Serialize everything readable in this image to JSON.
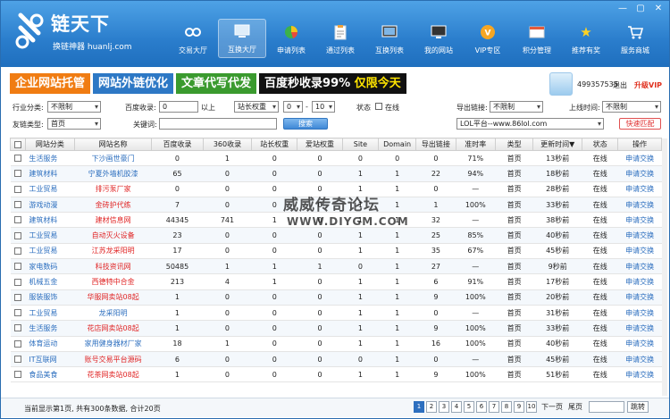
{
  "app": {
    "title": "链天下",
    "subtitle": "换链神器 huanlj.com",
    "window_controls": [
      "—",
      "▢",
      "✕"
    ]
  },
  "nav": [
    {
      "label": "交易大厅",
      "icon": "link-icon"
    },
    {
      "label": "互换大厅",
      "icon": "monitor-icon",
      "active": true
    },
    {
      "label": "申请列表",
      "icon": "pie-chart-icon"
    },
    {
      "label": "通过列表",
      "icon": "clipboard-icon"
    },
    {
      "label": "互换列表",
      "icon": "screen-icon"
    },
    {
      "label": "我的网站",
      "icon": "monitor-icon"
    },
    {
      "label": "VIP专区",
      "icon": "vip-icon"
    },
    {
      "label": "积分管理",
      "icon": "window-icon"
    },
    {
      "label": "推荐有奖",
      "icon": "star-icon"
    },
    {
      "label": "服务商城",
      "icon": "cart-icon"
    }
  ],
  "banner": {
    "b1": "企业网站托管",
    "b2": "网站外链优化",
    "b3": "文章代写代发",
    "b4_a": "百度秒收录99%",
    "b4_b": "仅限今天"
  },
  "user": {
    "id": "499357535",
    "logout": "退出",
    "upgrade": "升级VIP"
  },
  "filters": {
    "industry_label": "行业分类:",
    "industry_value": "不限制",
    "baidu_label": "百度收录:",
    "baidu_value": "0",
    "baidu_suffix": "以上",
    "weight_value": "站长权重",
    "range_from": "0",
    "range_dash": "-",
    "range_to": "10",
    "status_label": "状态",
    "online_label": "在线",
    "export_label": "导出链接:",
    "export_value": "不限制",
    "online_time_label": "上线时间:",
    "online_time_value": "不限制",
    "friend_label": "友链类型:",
    "friend_value": "首页",
    "keyword_label": "关键词:",
    "search_btn": "搜索",
    "platform_value": "LOL平台--www.86lol.com",
    "fast_btn": "快速匹配"
  },
  "table": {
    "headers": [
      "",
      "网站分类",
      "网站名称",
      "百度收录",
      "360收录",
      "站长权重",
      "爱站权重",
      "Site",
      "Domain",
      "导出链接",
      "准时率",
      "类型",
      "更新时间▼",
      "状态",
      "操作"
    ],
    "rows": [
      [
        "生活服务",
        "下沙画世豪门",
        "0",
        "1",
        "0",
        "0",
        "0",
        "0",
        "0",
        "71%",
        "首页",
        "13秒前",
        "在线",
        "申请交换"
      ],
      [
        "建筑材料",
        "宁夏外墙机胶漆",
        "65",
        "0",
        "0",
        "0",
        "1",
        "1",
        "22",
        "94%",
        "首页",
        "18秒前",
        "在线",
        "申请交换"
      ],
      [
        "工业贸易",
        "排污泵厂家",
        "0",
        "0",
        "0",
        "0",
        "1",
        "1",
        "0",
        "—",
        "首页",
        "28秒前",
        "在线",
        "申请交换"
      ],
      [
        "游戏动漫",
        "金砖护代练",
        "7",
        "0",
        "0",
        "0",
        "1",
        "1",
        "1",
        "100%",
        "首页",
        "33秒前",
        "在线",
        "申请交换"
      ],
      [
        "建筑材料",
        "建材信息网",
        "44345",
        "741",
        "1",
        "0",
        "1",
        "1",
        "32",
        "—",
        "首页",
        "38秒前",
        "在线",
        "申请交换"
      ],
      [
        "工业贸易",
        "自动灭火设备",
        "23",
        "0",
        "0",
        "0",
        "1",
        "1",
        "25",
        "85%",
        "首页",
        "40秒前",
        "在线",
        "申请交换"
      ],
      [
        "工业贸易",
        "江苏龙采阳明",
        "17",
        "0",
        "0",
        "0",
        "1",
        "1",
        "35",
        "67%",
        "首页",
        "45秒前",
        "在线",
        "申请交换"
      ],
      [
        "家电数码",
        "科技资讯网",
        "50485",
        "1",
        "1",
        "1",
        "0",
        "1",
        "27",
        "—",
        "首页",
        "9秒前",
        "在线",
        "申请交换"
      ],
      [
        "机械五金",
        "西德特中合金",
        "213",
        "4",
        "1",
        "0",
        "1",
        "1",
        "6",
        "91%",
        "首页",
        "17秒前",
        "在线",
        "申请交换"
      ],
      [
        "服装服饰",
        "华服网卖站08起",
        "1",
        "0",
        "0",
        "0",
        "1",
        "1",
        "9",
        "100%",
        "首页",
        "20秒前",
        "在线",
        "申请交换"
      ],
      [
        "工业贸易",
        "龙采阳明",
        "1",
        "0",
        "0",
        "0",
        "1",
        "1",
        "0",
        "—",
        "首页",
        "31秒前",
        "在线",
        "申请交换"
      ],
      [
        "生活服务",
        "花店网卖站08起",
        "1",
        "0",
        "0",
        "0",
        "1",
        "1",
        "9",
        "100%",
        "首页",
        "33秒前",
        "在线",
        "申请交换"
      ],
      [
        "体育运动",
        "家用健身器材厂家",
        "18",
        "1",
        "0",
        "0",
        "1",
        "1",
        "16",
        "100%",
        "首页",
        "40秒前",
        "在线",
        "申请交换"
      ],
      [
        "IT互联网",
        "账号交易平台源码",
        "6",
        "0",
        "0",
        "0",
        "0",
        "1",
        "0",
        "—",
        "首页",
        "45秒前",
        "在线",
        "申请交换"
      ],
      [
        "食品美食",
        "花茶网卖站08起",
        "1",
        "0",
        "0",
        "0",
        "1",
        "1",
        "9",
        "100%",
        "首页",
        "51秒前",
        "在线",
        "申请交换"
      ]
    ],
    "red_name_rows": [
      2,
      3,
      4,
      5,
      6,
      7,
      8,
      9,
      11,
      13,
      14
    ]
  },
  "footer": {
    "summary": "当前显示第1页, 共有300条数据, 合计20页",
    "pages": [
      "1",
      "2",
      "3",
      "4",
      "5",
      "6",
      "7",
      "8",
      "9",
      "10"
    ],
    "next": "下一页",
    "last": "尾页",
    "go": "跳转"
  },
  "watermark": {
    "line1": "威威传奇论坛",
    "line2": "WWW.DIYGM.COM"
  },
  "colors": {
    "accent": "#2d6fbf",
    "red": "#e02525",
    "orange": "#f07c12",
    "green": "#3a9a2e"
  }
}
